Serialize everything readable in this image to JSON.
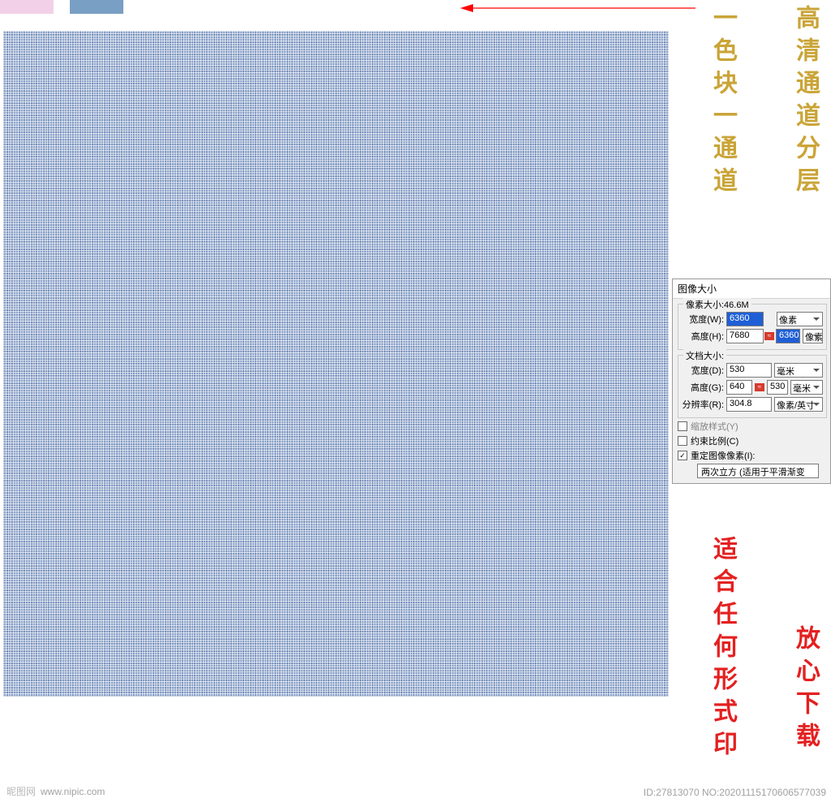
{
  "swatches": {
    "pink": "#f2d1e8",
    "blue": "#7a9fc4"
  },
  "annotations": {
    "gold1": "一色块一通道",
    "gold2": "高清通道分层",
    "red1": "适合任何形式印",
    "red2": "放心下载"
  },
  "dialog": {
    "title": "图像大小",
    "pixel_dims": {
      "legend": "像素大小:46.6M",
      "width_label": "宽度(W):",
      "width_value": "6360",
      "height_label": "高度(H):",
      "height_value": "7680",
      "height_hint": "6360",
      "unit": "像素"
    },
    "doc_size": {
      "legend": "文档大小:",
      "width_label": "宽度(D):",
      "width_value": "530",
      "height_label": "高度(G):",
      "height_value": "640",
      "height_hint": "530",
      "unit": "毫米",
      "res_label": "分辨率(R):",
      "res_value": "304.8",
      "res_unit": "像素/英寸"
    },
    "scale_styles_label": "缩放样式(Y)",
    "constrain_label": "约束比例(C)",
    "resample_label": "重定图像像素(I):",
    "interp": "两次立方 (适用于平滑渐变"
  },
  "watermark": {
    "left_logo": "昵图网",
    "left_url": "www.nipic.com",
    "right": "ID:27813070 NO:20201115170606577039"
  }
}
